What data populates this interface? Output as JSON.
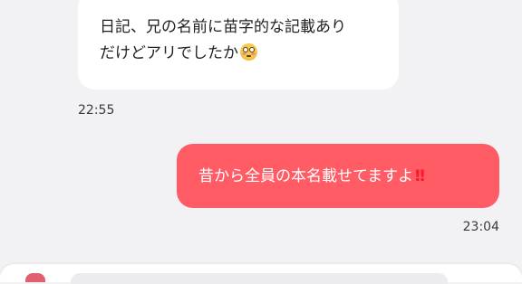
{
  "messages": [
    {
      "direction": "incoming",
      "lines": [
        "日記、兄の名前に苗字的な記載あり",
        "だけどアリでしたか"
      ],
      "emoji": "flushed-face-emoji",
      "time": "22:55"
    },
    {
      "direction": "outgoing",
      "text": "昔から全員の本名載せてますよ",
      "emoji_text": "‼",
      "time": "23:04"
    }
  ],
  "colors": {
    "background": "#f2f2f4",
    "incoming_bubble": "#ffffff",
    "outgoing_bubble": "#ff5c66",
    "outgoing_text": "#ffffff"
  },
  "composer": {
    "icon": "sticker-icon"
  }
}
